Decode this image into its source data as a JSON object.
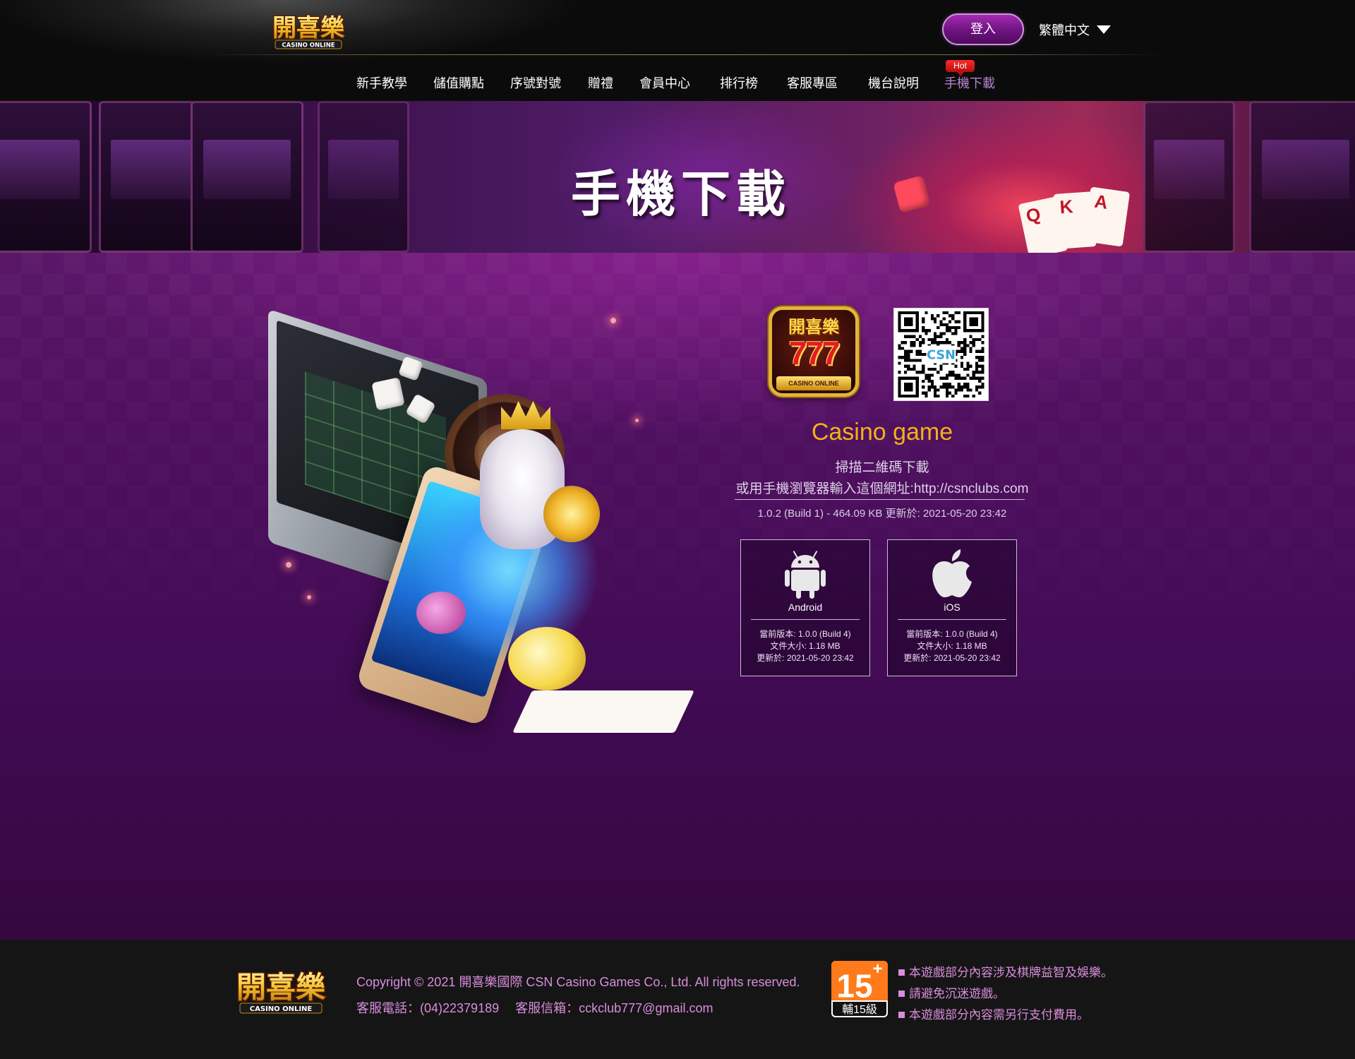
{
  "header": {
    "logo_text": "開喜樂",
    "logo_sub": "CASINO ONLINE",
    "login_label": "登入",
    "language": "繁體中文",
    "icons": {
      "language_caret": "caret-down-icon"
    }
  },
  "nav": {
    "items": [
      {
        "label": "新手教學"
      },
      {
        "label": "儲值購點"
      },
      {
        "label": "序號對號"
      },
      {
        "label": "贈禮"
      },
      {
        "label": "會員中心"
      },
      {
        "label": "排行榜"
      },
      {
        "label": "客服專區"
      },
      {
        "label": "機台說明"
      },
      {
        "label": "手機下載",
        "active": true,
        "badge": "Hot"
      }
    ]
  },
  "banner": {
    "title": "手機下載"
  },
  "download": {
    "app_icon_text": "開喜樂",
    "app_icon_sevens": "777",
    "app_icon_band": "CASINO ONLINE",
    "qr_label": "CSN",
    "title": "Casino game",
    "scan_text": "掃描二維碼下載",
    "url_text": "或用手機瀏覽器輸入這個網址:http://csnclubs.com",
    "version_line": "1.0.2 (Build 1) - 464.09 KB  更新於: 2021-05-20 23:42",
    "platforms": [
      {
        "name": "Android",
        "icon": "android-icon",
        "version": "當前版本: 1.0.0 (Build 4)",
        "size": "文件大小: 1.18 MB",
        "updated": "更新於: 2021-05-20 23:42"
      },
      {
        "name": "iOS",
        "icon": "apple-icon",
        "version": "當前版本: 1.0.0 (Build 4)",
        "size": "文件大小: 1.18 MB",
        "updated": "更新於: 2021-05-20 23:42"
      }
    ]
  },
  "footer": {
    "copyright": "Copyright © 2021   開喜樂國際 CSN Casino Games Co., Ltd. All rights reserved.",
    "phone": "客服電話：(04)22379189",
    "email": "客服信箱：cckclub777@gmail.com",
    "rating_num": "15",
    "rating_plus": "+",
    "rating_label": "輔15級",
    "notices": [
      "本遊戲部分內容涉及棋牌益智及娛樂。",
      "請避免沉迷遊戲。",
      "本遊戲部分內容需另行支付費用。"
    ]
  },
  "colors": {
    "accent_purple": "#8a1c9c",
    "title_gold": "#f2b218",
    "footer_pink": "#d98ddc",
    "active_nav": "#b784d1",
    "hot_red": "#e01818"
  }
}
